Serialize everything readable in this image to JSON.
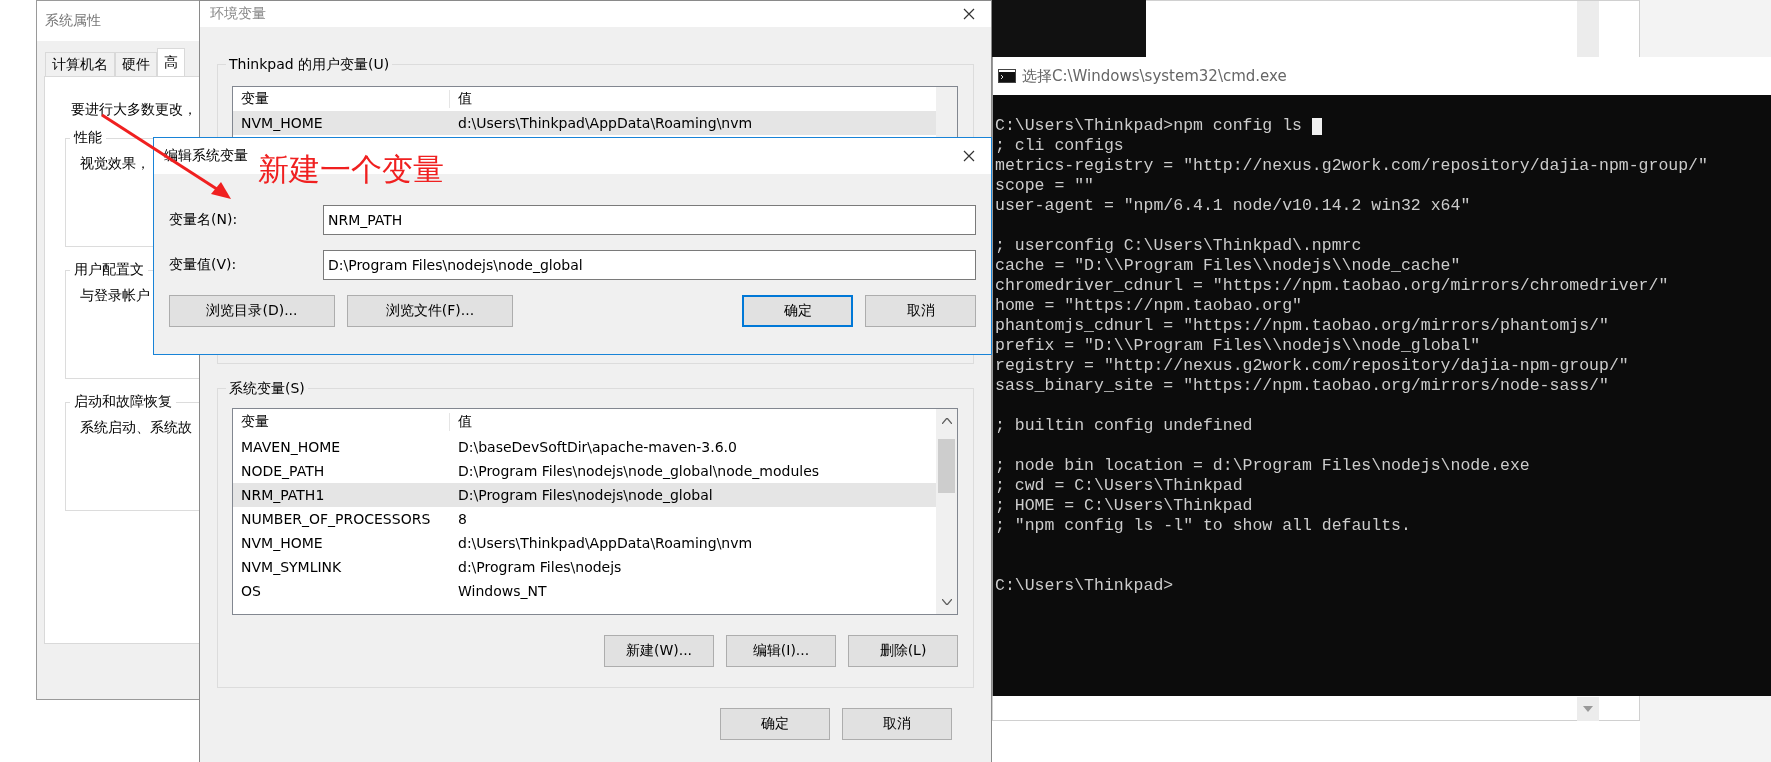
{
  "system_properties": {
    "title": "系统属性",
    "tabs": [
      {
        "label": "计算机名",
        "selected": false
      },
      {
        "label": "硬件",
        "selected": false
      },
      {
        "label": "高",
        "selected": true
      }
    ],
    "intro": "要进行大多数更改，",
    "groups": [
      {
        "title": "性能",
        "text": "视觉效果，"
      },
      {
        "title": "用户配置文",
        "text": "与登录帐户"
      },
      {
        "title": "启动和故障恢复",
        "text": "系统启动、系统故"
      }
    ]
  },
  "environment_variables": {
    "title": "环境变量",
    "user_variables": {
      "title": "Thinkpad 的用户变量(U)",
      "columns": [
        "变量",
        "值"
      ],
      "rows": [
        {
          "name": "NVM_HOME",
          "value": "d:\\Users\\Thinkpad\\AppData\\Roaming\\nvm",
          "selected": true
        }
      ]
    },
    "system_variables": {
      "title": "系统变量(S)",
      "columns": [
        "变量",
        "值"
      ],
      "rows": [
        {
          "name": "MAVEN_HOME",
          "value": "D:\\baseDevSoftDir\\apache-maven-3.6.0",
          "selected": false
        },
        {
          "name": "NODE_PATH",
          "value": "D:\\Program Files\\nodejs\\node_global\\node_modules",
          "selected": false
        },
        {
          "name": "NRM_PATH1",
          "value": "D:\\Program Files\\nodejs\\node_global",
          "selected": true
        },
        {
          "name": "NUMBER_OF_PROCESSORS",
          "value": "8",
          "selected": false
        },
        {
          "name": "NVM_HOME",
          "value": "d:\\Users\\Thinkpad\\AppData\\Roaming\\nvm",
          "selected": false
        },
        {
          "name": "NVM_SYMLINK",
          "value": "d:\\Program Files\\nodejs",
          "selected": false
        },
        {
          "name": "OS",
          "value": "Windows_NT",
          "selected": false
        }
      ],
      "buttons": [
        "新建(W)...",
        "编辑(I)...",
        "删除(L)"
      ]
    },
    "buttons": [
      "确定",
      "取消"
    ]
  },
  "edit_dialog": {
    "title": "编辑系统变量",
    "fields": [
      {
        "label": "变量名(N):",
        "value": "NRM_PATH"
      },
      {
        "label": "变量值(V):",
        "value": "D:\\Program Files\\nodejs\\node_global"
      }
    ],
    "browse_buttons": [
      "浏览目录(D)...",
      "浏览文件(F)..."
    ],
    "buttons": [
      {
        "label": "确定",
        "default": true
      },
      {
        "label": "取消",
        "default": false
      }
    ]
  },
  "annotation": {
    "text": "新建一个变量"
  },
  "console": {
    "title": "选择C:\\Windows\\system32\\cmd.exe",
    "cursor": true,
    "blocks": [
      [
        "C:\\Users\\Thinkpad>npm config ls",
        "; cli configs",
        "metrics-registry = \"http://nexus.g2work.com/repository/dajia-npm-group/\"",
        "scope = \"\"",
        "user-agent = \"npm/6.4.1 node/v10.14.2 win32 x64\""
      ],
      [
        "; userconfig C:\\Users\\Thinkpad\\.npmrc",
        "cache = \"D:\\\\Program Files\\\\nodejs\\\\node_cache\"",
        "chromedriver_cdnurl = \"https://npm.taobao.org/mirrors/chromedriver/\"",
        "home = \"https://npm.taobao.org\"",
        "phantomjs_cdnurl = \"https://npm.taobao.org/mirrors/phantomjs/\"",
        "prefix = \"D:\\\\Program Files\\\\nodejs\\\\node_global\"",
        "registry = \"http://nexus.g2work.com/repository/dajia-npm-group/\"",
        "sass_binary_site = \"https://npm.taobao.org/mirrors/node-sass/\""
      ],
      [
        "; builtin config undefined"
      ],
      [
        "; node bin location = d:\\Program Files\\nodejs\\node.exe",
        "; cwd = C:\\Users\\Thinkpad",
        "; HOME = C:\\Users\\Thinkpad",
        "; \"npm config ls -l\" to show all defaults."
      ],
      [
        "C:\\Users\\Thinkpad>"
      ]
    ]
  }
}
